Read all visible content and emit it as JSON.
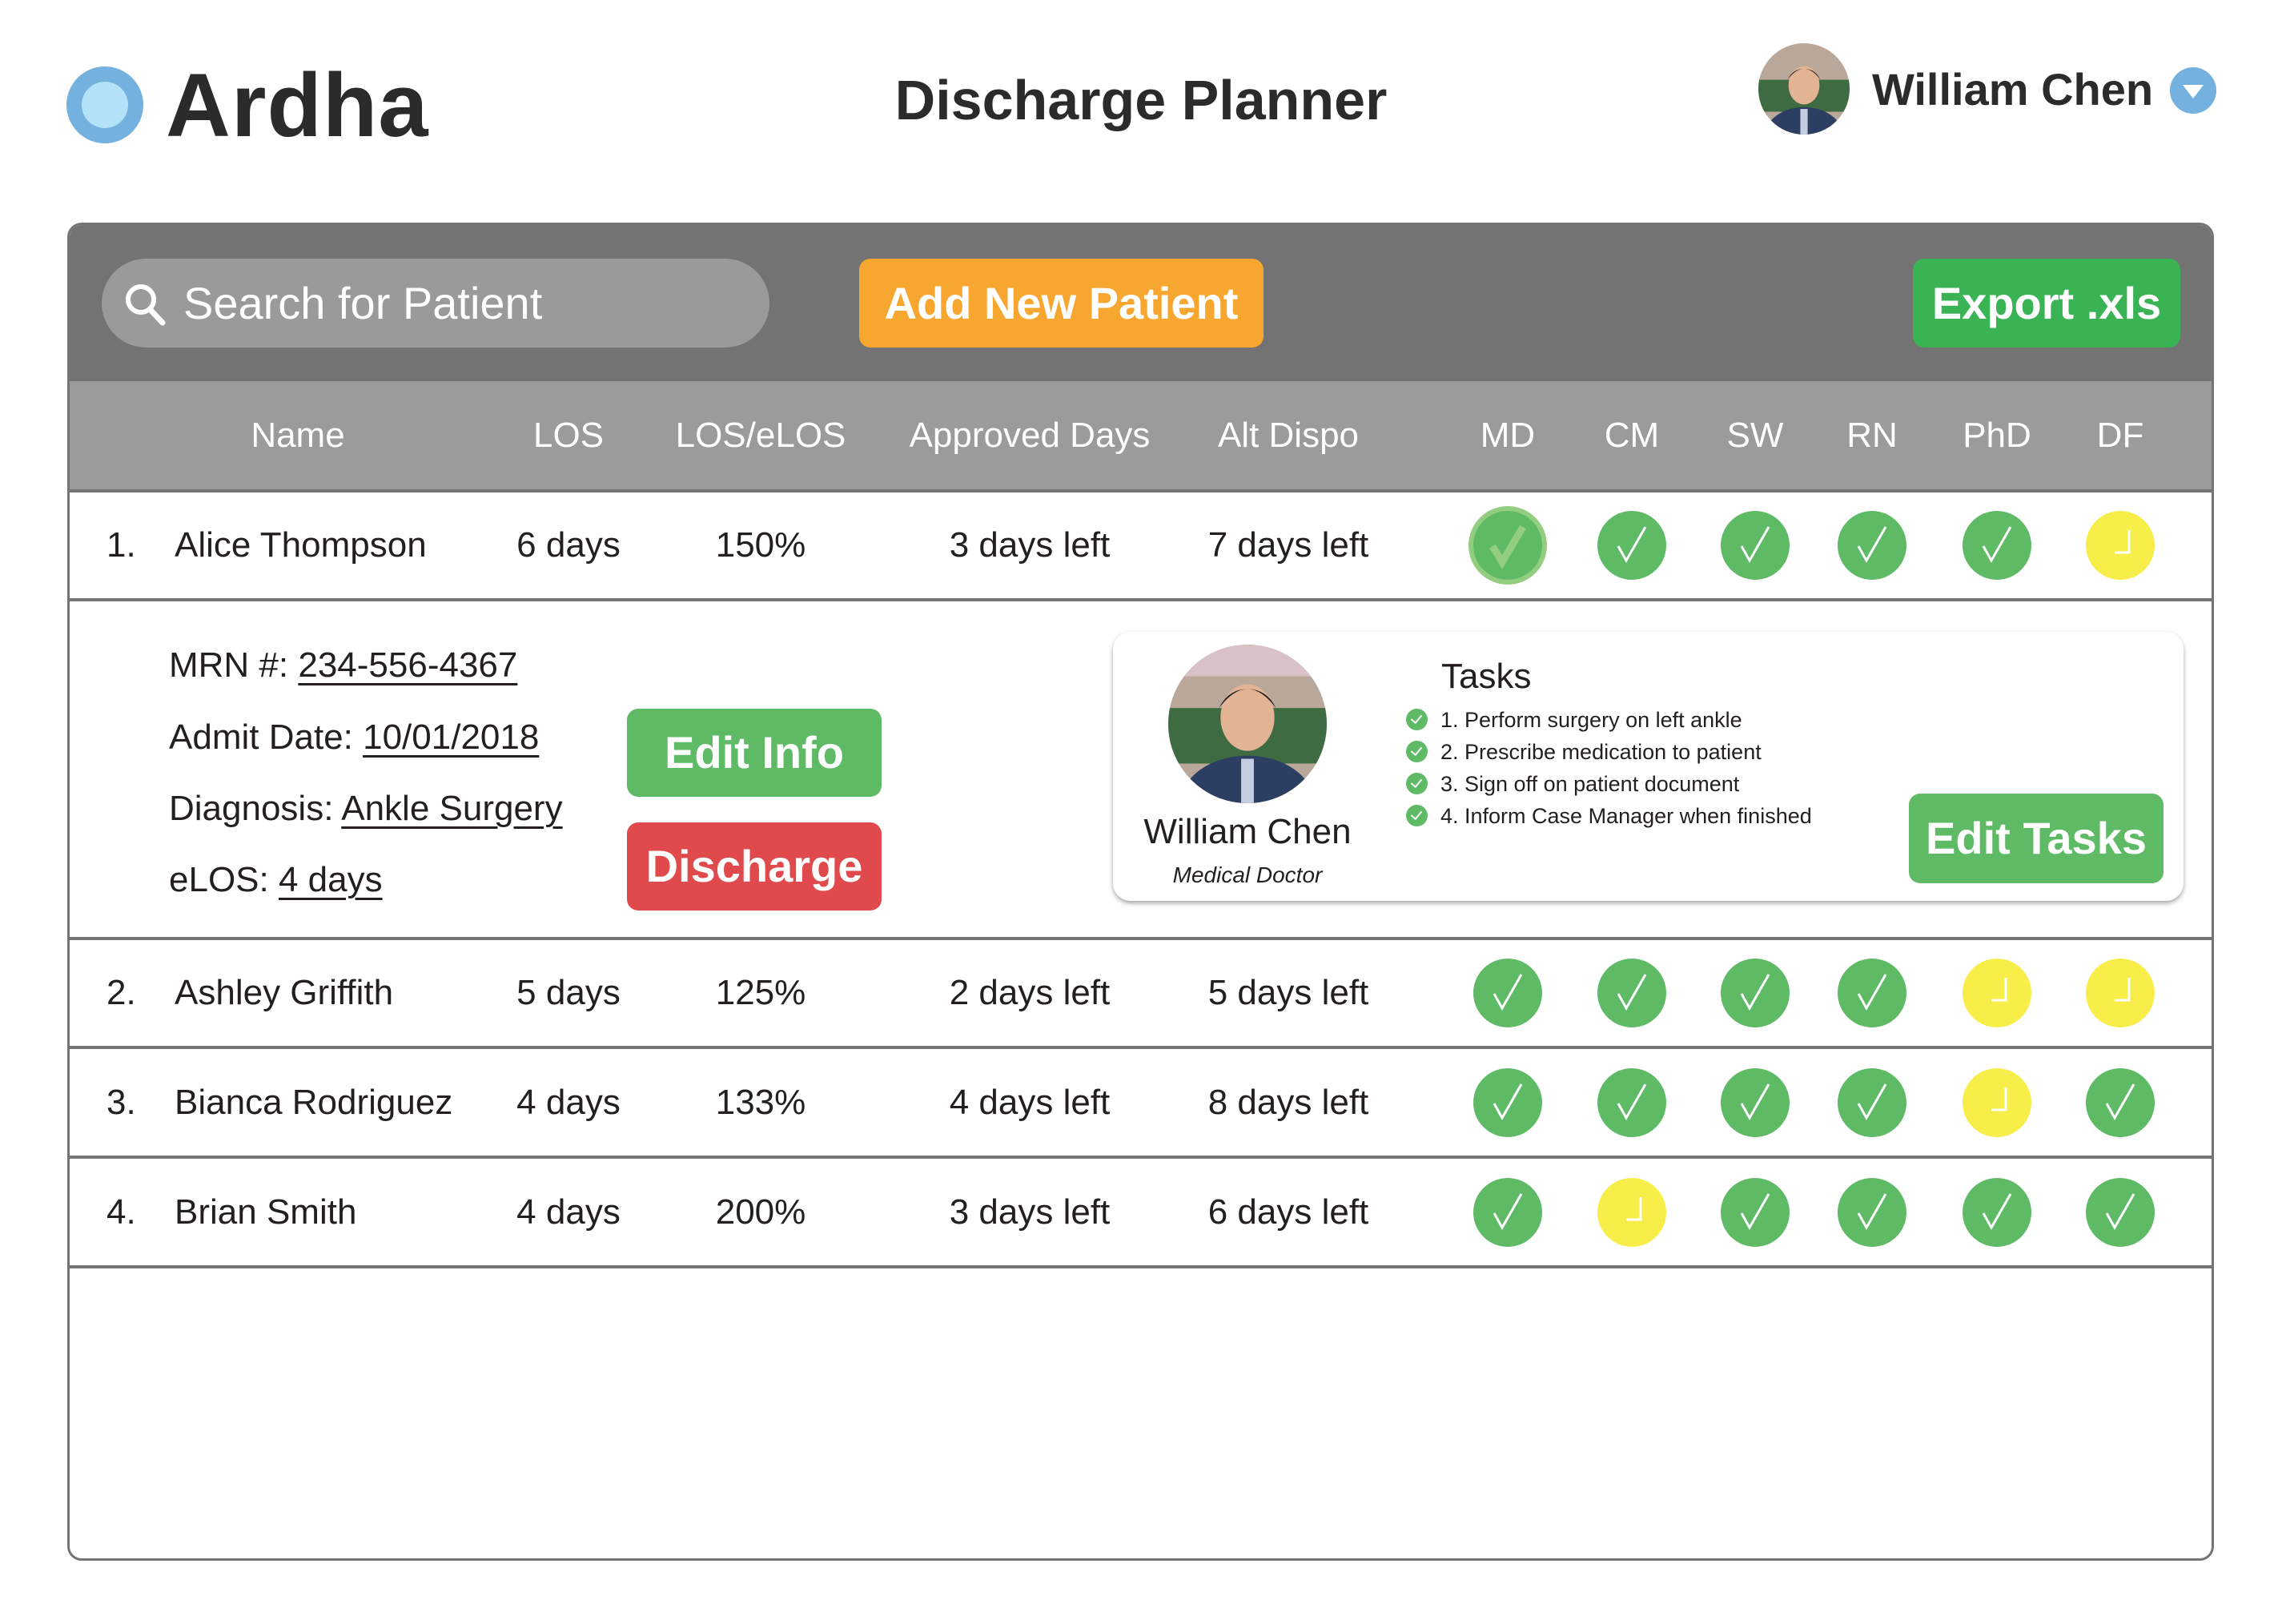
{
  "app": {
    "brand": "Ardha",
    "page_title": "Discharge Planner",
    "user": {
      "name": "William Chen",
      "avatar": "user-photo",
      "menu_icon": "chevron-down-icon"
    }
  },
  "toolbar": {
    "search_placeholder": "Search for Patient",
    "search_value": "",
    "add_patient_label": "Add New Patient",
    "export_label": "Export .xls"
  },
  "colors": {
    "done": "#5fba66",
    "pending": "#f7ee4a",
    "add_button": "#f7a630",
    "export_button": "#3ab354",
    "discharge_button": "#e04a4c",
    "brand_blue": "#74b1df"
  },
  "table": {
    "columns": [
      "Name",
      "LOS",
      "LOS/eLOS",
      "Approved Days",
      "Alt Dispo",
      "MD",
      "CM",
      "SW",
      "RN",
      "PhD",
      "DF"
    ],
    "rows": [
      {
        "num": "1.",
        "name": "Alice Thompson",
        "los": "6 days",
        "los_elos": "150%",
        "approved": "3 days left",
        "alt_dispo": "7 days left",
        "status": [
          "selected",
          "done",
          "done",
          "done",
          "done",
          "pending"
        ],
        "expanded": true
      },
      {
        "num": "2.",
        "name": "Ashley Griffith",
        "los": "5 days",
        "los_elos": "125%",
        "approved": "2 days left",
        "alt_dispo": "5 days left",
        "status": [
          "done",
          "done",
          "done",
          "done",
          "pending",
          "pending"
        ]
      },
      {
        "num": "3.",
        "name": "Bianca Rodriguez",
        "los": "4 days",
        "los_elos": "133%",
        "approved": "4 days left",
        "alt_dispo": "8 days left",
        "status": [
          "done",
          "done",
          "done",
          "done",
          "pending",
          "done"
        ]
      },
      {
        "num": "4.",
        "name": "Brian Smith",
        "los": "4 days",
        "los_elos": "200%",
        "approved": "3 days left",
        "alt_dispo": "6 days left",
        "status": [
          "done",
          "pending",
          "done",
          "done",
          "done",
          "done"
        ]
      }
    ]
  },
  "detail": {
    "mrn_label": "MRN #:",
    "mrn": "234-556-4367",
    "admit_label": "Admit Date:",
    "admit_date": "10/01/2018",
    "diagnosis_label": "Diagnosis:",
    "diagnosis": "Ankle Surgery",
    "elos_label": "eLOS:",
    "elos": "4 days",
    "edit_info_label": "Edit Info",
    "discharge_label": "Discharge",
    "card": {
      "name": "William Chen",
      "role": "Medical Doctor",
      "tasks_title": "Tasks",
      "tasks": [
        {
          "text": "1. Perform surgery on left ankle",
          "done": true
        },
        {
          "text": "2. Prescribe medication to patient",
          "done": true
        },
        {
          "text": "3. Sign off on patient document",
          "done": true
        },
        {
          "text": "4. Inform Case Manager when finished",
          "done": true
        }
      ],
      "edit_tasks_label": "Edit Tasks"
    }
  }
}
